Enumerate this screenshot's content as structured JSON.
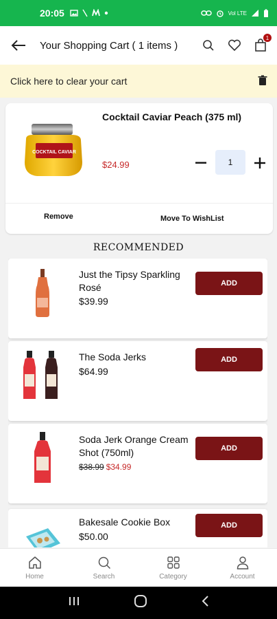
{
  "status_bar": {
    "time": "20:05",
    "left_icons": [
      "image-icon",
      "slash-icon",
      "m-icon",
      "dot-icon"
    ],
    "right_icons": [
      "link-icon",
      "alarm-icon",
      "volte-icon",
      "signal-icon",
      "battery-icon"
    ],
    "right_text": "Vol LTE"
  },
  "header": {
    "title": "Your Shopping Cart ( 1 items )",
    "cart_count": "1"
  },
  "clear_banner": {
    "text": "Click here to clear your cart"
  },
  "cart_item": {
    "name": "Cocktail Caviar Peach (375 ml)",
    "price": "$24.99",
    "quantity": "1",
    "label_text": "COCKTAIL CAVIAR",
    "remove_label": "Remove",
    "wishlist_label": "Move To WishList"
  },
  "recommended": {
    "title": "RECOMMENDED",
    "add_label": "ADD",
    "items": [
      {
        "name": "Just the Tipsy Sparkling Rosé",
        "price": "$39.99"
      },
      {
        "name": "The Soda Jerks",
        "price": "$64.99"
      },
      {
        "name": "Soda Jerk Orange Cream Shot (750ml)",
        "old_price": "$38.99",
        "sale_price": "$34.99"
      },
      {
        "name": "Bakesale Cookie Box",
        "price": "$50.00"
      }
    ]
  },
  "bottom_nav": {
    "items": [
      {
        "label": "Home",
        "icon": "home-icon"
      },
      {
        "label": "Search",
        "icon": "search-icon"
      },
      {
        "label": "Category",
        "icon": "category-icon"
      },
      {
        "label": "Account",
        "icon": "account-icon"
      }
    ]
  },
  "colors": {
    "status_green": "#16b54e",
    "add_button": "#7a1416",
    "price_red": "#c62828",
    "banner": "#fdf7d7"
  }
}
